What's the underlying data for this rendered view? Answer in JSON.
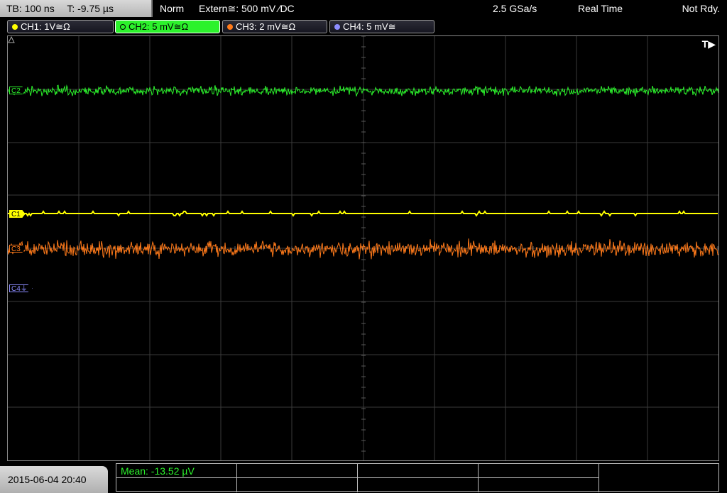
{
  "topbar": {
    "timebase": "TB: 100 ns",
    "trigger_time": "T: -9.75 µs",
    "trigger_mode": "Norm",
    "trigger_source": "Extern≅: 500 mV ∕DC",
    "sample_rate": "2.5 GSa/s",
    "acquisition_mode": "Real Time",
    "status": "Not Rdy."
  },
  "channels": [
    {
      "label": "CH1: 1V≅Ω",
      "color": "#ffff00",
      "marker": "C1"
    },
    {
      "label": "CH2: 5 mV≅Ω",
      "color": "#2cf22c",
      "marker": "C2"
    },
    {
      "label": "CH3: 2 mV≅Ω",
      "color": "#ff7a1a",
      "marker": "C3"
    },
    {
      "label": "CH4: 5 mV≅",
      "color": "#8c8cff",
      "marker": "C4⏚"
    }
  ],
  "trigger_position_label": "T▶",
  "footer": {
    "datetime": "2015-06-04 20:40",
    "measurement": "Mean: -13.52 µV"
  }
}
